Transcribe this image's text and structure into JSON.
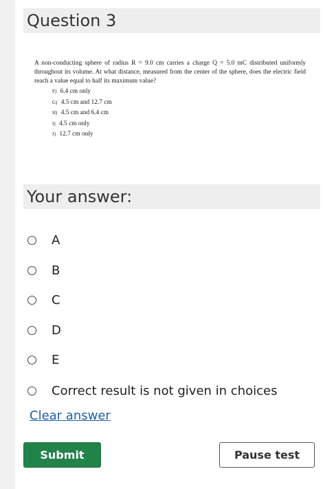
{
  "question": {
    "title": "Question 3",
    "text": "A non-conducting sphere of radius R = 9.0 cm carries a charge Q = 5.0 mC distributed uniformly throughout its volume. At what distance, measured from the center of the sphere, does the electric field reach a value equal to half its maximum value?",
    "choices": [
      {
        "letter": "F)",
        "text": "6.4 cm only"
      },
      {
        "letter": "G)",
        "text": "4.5 cm and 12.7 cm"
      },
      {
        "letter": "H)",
        "text": "4.5 cm and 6.4 cm"
      },
      {
        "letter": "I)",
        "text": "4.5 cm only"
      },
      {
        "letter": "J)",
        "text": "12.7 cm only"
      }
    ]
  },
  "answer": {
    "header": "Your answer:",
    "options": [
      {
        "label": "A"
      },
      {
        "label": "B"
      },
      {
        "label": "C"
      },
      {
        "label": "D"
      },
      {
        "label": "E"
      },
      {
        "label": "Correct result is not given in choices"
      }
    ],
    "clear_label": "Clear answer"
  },
  "buttons": {
    "submit_label": "Submit",
    "pause_label": "Pause test"
  },
  "colors": {
    "submit_bg": "#22834a",
    "link": "#1d5fa8",
    "header_bg": "#eeeeee"
  }
}
